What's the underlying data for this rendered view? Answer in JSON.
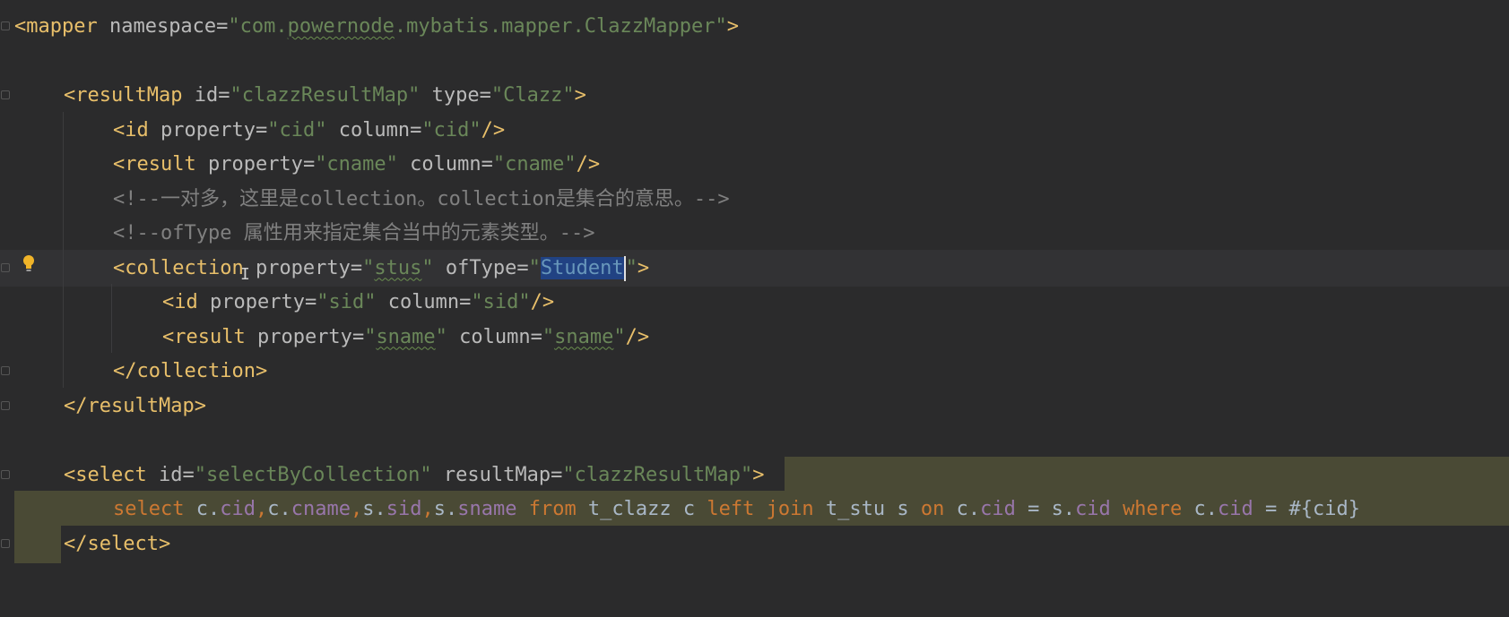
{
  "editor": {
    "lines": [
      {
        "segments": [
          [
            "tag",
            "<mapper"
          ],
          [
            "attr",
            " namespace"
          ],
          [
            "eq",
            "="
          ],
          [
            "str",
            "\"com."
          ],
          [
            "str-u",
            "powernode"
          ],
          [
            "str",
            ".mybatis.mapper.ClazzMapper\""
          ],
          [
            "tag",
            ">"
          ]
        ]
      },
      {
        "segments": []
      },
      {
        "segments": [
          [
            "tag",
            "<resultMap"
          ],
          [
            "attr",
            " id"
          ],
          [
            "eq",
            "="
          ],
          [
            "str",
            "\"clazzResultMap\""
          ],
          [
            "attr",
            " type"
          ],
          [
            "eq",
            "="
          ],
          [
            "str",
            "\"Clazz\""
          ],
          [
            "tag",
            ">"
          ]
        ]
      },
      {
        "segments": [
          [
            "tag",
            "<id"
          ],
          [
            "attr",
            " property"
          ],
          [
            "eq",
            "="
          ],
          [
            "str",
            "\"cid\""
          ],
          [
            "attr",
            " column"
          ],
          [
            "eq",
            "="
          ],
          [
            "str",
            "\"cid\""
          ],
          [
            "tag",
            "/>"
          ]
        ]
      },
      {
        "segments": [
          [
            "tag",
            "<result"
          ],
          [
            "attr",
            " property"
          ],
          [
            "eq",
            "="
          ],
          [
            "str",
            "\"cname\""
          ],
          [
            "attr",
            " column"
          ],
          [
            "eq",
            "="
          ],
          [
            "str",
            "\"cname\""
          ],
          [
            "tag",
            "/>"
          ]
        ]
      },
      {
        "segments": [
          [
            "cmt",
            "<!--一对多，这里是collection。collection是集合的意思。-->"
          ]
        ]
      },
      {
        "segments": [
          [
            "cmt",
            "<!--ofType 属性用来指定集合当中的元素类型。-->"
          ]
        ]
      },
      {
        "segments": [
          [
            "tag",
            "<collection"
          ],
          [
            "attr",
            " property"
          ],
          [
            "eq",
            "="
          ],
          [
            "str",
            "\""
          ],
          [
            "str-u",
            "stus"
          ],
          [
            "str",
            "\""
          ],
          [
            "attr",
            " ofType"
          ],
          [
            "eq",
            "="
          ],
          [
            "str",
            "\""
          ],
          [
            "sel",
            "Student"
          ],
          [
            "caret",
            ""
          ],
          [
            "str",
            "\""
          ],
          [
            "tag",
            ">"
          ]
        ]
      },
      {
        "segments": [
          [
            "tag",
            "<id"
          ],
          [
            "attr",
            " property"
          ],
          [
            "eq",
            "="
          ],
          [
            "str",
            "\"sid\""
          ],
          [
            "attr",
            " column"
          ],
          [
            "eq",
            "="
          ],
          [
            "str",
            "\"sid\""
          ],
          [
            "tag",
            "/>"
          ]
        ]
      },
      {
        "segments": [
          [
            "tag",
            "<result"
          ],
          [
            "attr",
            " property"
          ],
          [
            "eq",
            "="
          ],
          [
            "str",
            "\""
          ],
          [
            "str-u",
            "sname"
          ],
          [
            "str",
            "\""
          ],
          [
            "attr",
            " column"
          ],
          [
            "eq",
            "="
          ],
          [
            "str",
            "\""
          ],
          [
            "str-u",
            "sname"
          ],
          [
            "str",
            "\""
          ],
          [
            "tag",
            "/>"
          ]
        ]
      },
      {
        "segments": [
          [
            "tag",
            "</collection>"
          ]
        ]
      },
      {
        "segments": [
          [
            "tag",
            "</resultMap>"
          ]
        ]
      },
      {
        "segments": []
      },
      {
        "segments": [
          [
            "tag",
            "<select"
          ],
          [
            "attr",
            " id"
          ],
          [
            "eq",
            "="
          ],
          [
            "str",
            "\"selectByCollection\""
          ],
          [
            "attr",
            " resultMap"
          ],
          [
            "eq",
            "="
          ],
          [
            "str",
            "\"clazzResultMap\""
          ],
          [
            "tag",
            ">"
          ]
        ]
      },
      {
        "segments": [
          [
            "kw",
            "select"
          ],
          [
            "plain",
            " c."
          ],
          [
            "fld",
            "cid"
          ],
          [
            "kw",
            ","
          ],
          [
            "plain",
            "c."
          ],
          [
            "fld",
            "cname"
          ],
          [
            "kw",
            ","
          ],
          [
            "plain",
            "s."
          ],
          [
            "fld",
            "sid"
          ],
          [
            "kw",
            ","
          ],
          [
            "plain",
            "s."
          ],
          [
            "fld",
            "sname"
          ],
          [
            "plain",
            " "
          ],
          [
            "kw",
            "from"
          ],
          [
            "plain",
            " t_clazz c "
          ],
          [
            "kw",
            "left join"
          ],
          [
            "plain",
            " t_stu s "
          ],
          [
            "kw",
            "on"
          ],
          [
            "plain",
            " c."
          ],
          [
            "fld",
            "cid"
          ],
          [
            "plain",
            " = s."
          ],
          [
            "fld",
            "cid"
          ],
          [
            "plain",
            " "
          ],
          [
            "kw",
            "where"
          ],
          [
            "plain",
            " c."
          ],
          [
            "fld",
            "cid"
          ],
          [
            "plain",
            " = #{cid}"
          ]
        ]
      },
      {
        "segments": [
          [
            "tag",
            "</select>"
          ]
        ]
      }
    ],
    "colors": {
      "background": "#2b2b2c",
      "tag": "#e8bf6a",
      "attribute": "#bababa",
      "string": "#6a8759",
      "comment": "#808080",
      "keyword": "#cc7832",
      "field": "#9876aa",
      "selection": "#214283",
      "sql_band": "#4a4a35"
    },
    "icons": [
      "lightbulb-icon",
      "fold-icon",
      "text-cursor-icon"
    ]
  }
}
